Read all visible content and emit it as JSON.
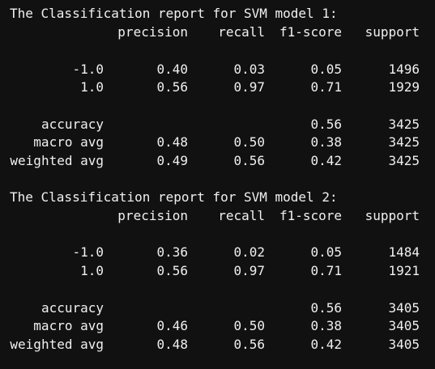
{
  "reports": [
    {
      "title": "The Classification report for SVM model 1:",
      "headers": [
        "precision",
        "recall",
        "f1-score",
        "support"
      ],
      "rows": [
        {
          "label": "-1.0",
          "precision": "0.40",
          "recall": "0.03",
          "f1": "0.05",
          "support": "1496"
        },
        {
          "label": "1.0",
          "precision": "0.56",
          "recall": "0.97",
          "f1": "0.71",
          "support": "1929"
        },
        {
          "label": "accuracy",
          "precision": "",
          "recall": "",
          "f1": "0.56",
          "support": "3425"
        },
        {
          "label": "macro avg",
          "precision": "0.48",
          "recall": "0.50",
          "f1": "0.38",
          "support": "3425"
        },
        {
          "label": "weighted avg",
          "precision": "0.49",
          "recall": "0.56",
          "f1": "0.42",
          "support": "3425"
        }
      ]
    },
    {
      "title": "The Classification report for SVM model 2:",
      "headers": [
        "precision",
        "recall",
        "f1-score",
        "support"
      ],
      "rows": [
        {
          "label": "-1.0",
          "precision": "0.36",
          "recall": "0.02",
          "f1": "0.05",
          "support": "1484"
        },
        {
          "label": "1.0",
          "precision": "0.56",
          "recall": "0.97",
          "f1": "0.71",
          "support": "1921"
        },
        {
          "label": "accuracy",
          "precision": "",
          "recall": "",
          "f1": "0.56",
          "support": "3405"
        },
        {
          "label": "macro avg",
          "precision": "0.46",
          "recall": "0.50",
          "f1": "0.38",
          "support": "3405"
        },
        {
          "label": "weighted avg",
          "precision": "0.48",
          "recall": "0.56",
          "f1": "0.42",
          "support": "3405"
        }
      ]
    }
  ]
}
